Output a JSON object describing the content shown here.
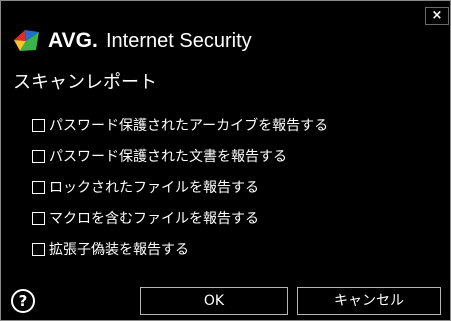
{
  "window": {
    "brand": "AVG.",
    "product": "Internet Security",
    "close_glyph": "×"
  },
  "dialog": {
    "section_title": "スキャンレポート",
    "options": [
      {
        "label": "パスワード保護されたアーカイブを報告する",
        "checked": false
      },
      {
        "label": "パスワード保護された文書を報告する",
        "checked": false
      },
      {
        "label": "ロックされたファイルを報告する",
        "checked": false
      },
      {
        "label": "マクロを含むファイルを報告する",
        "checked": false
      },
      {
        "label": "拡張子偽装を報告する",
        "checked": false
      }
    ]
  },
  "footer": {
    "help_glyph": "?",
    "ok_label": "OK",
    "cancel_label": "キャンセル"
  },
  "colors": {
    "background": "#000000",
    "text": "#ffffff",
    "logo_red": "#e32b26",
    "logo_blue": "#1f6fd1",
    "logo_green": "#39b34a",
    "logo_yellow": "#f7c22b"
  },
  "icons": [
    "avg-logo-icon",
    "close-icon",
    "help-icon",
    "checkbox-icon"
  ]
}
